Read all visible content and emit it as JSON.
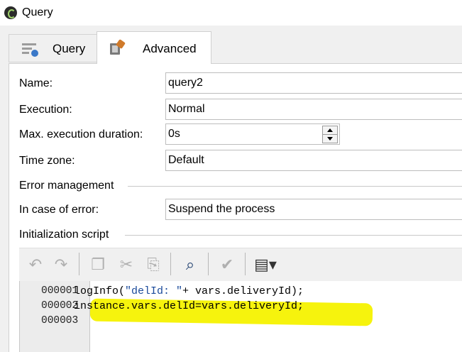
{
  "window": {
    "title": "Query"
  },
  "tabs": [
    {
      "label": "Query",
      "icon": "query-icon"
    },
    {
      "label": "Advanced",
      "icon": "advanced-icon"
    }
  ],
  "form": {
    "name": {
      "label": "Name:",
      "value": "query2"
    },
    "execution": {
      "label": "Execution:",
      "value": "Normal"
    },
    "max_duration": {
      "label": "Max. execution duration:",
      "value": "0s"
    },
    "time_zone": {
      "label": "Time zone:",
      "value": "Default"
    },
    "error_section": "Error management",
    "on_error": {
      "label": "In case of error:",
      "value": "Suspend the process"
    },
    "init_section": "Initialization script"
  },
  "toolbar": {
    "icons": [
      "undo-icon",
      "redo-icon",
      "copy-icon",
      "cut-icon",
      "paste-icon",
      "find-icon",
      "check-icon",
      "insert-menu-icon"
    ]
  },
  "script": {
    "line_numbers": [
      "000001",
      "000002",
      "000003"
    ],
    "line1": {
      "code": "logInfo(",
      "string": "\"delId: \"",
      "rest": "+ vars.deliveryId);"
    },
    "line2": "instance.vars.delId=vars.deliveryId;",
    "highlight_color": "#f5f200"
  }
}
